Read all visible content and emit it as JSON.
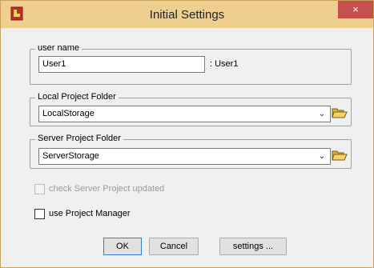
{
  "window": {
    "title": "Initial Settings",
    "close_label": "×"
  },
  "user_group": {
    "legend": "user name",
    "value": "User1",
    "display": ": User1"
  },
  "local_group": {
    "legend": "Local Project Folder",
    "value": "LocalStorage"
  },
  "server_group": {
    "legend": "Server Project Folder",
    "value": "ServerStorage"
  },
  "options": {
    "check_server_label": "check Server Project updated",
    "check_server_checked": false,
    "check_server_enabled": false,
    "use_pm_label": "use Project Manager",
    "use_pm_checked": false
  },
  "buttons": {
    "ok": "OK",
    "cancel": "Cancel",
    "settings": "settings ..."
  },
  "icons": {
    "app": "app-icon",
    "folder": "open-folder-icon",
    "dropdown": "chevron-down-icon"
  },
  "colors": {
    "titlebar": "#efcf8e",
    "close": "#c7504e"
  }
}
